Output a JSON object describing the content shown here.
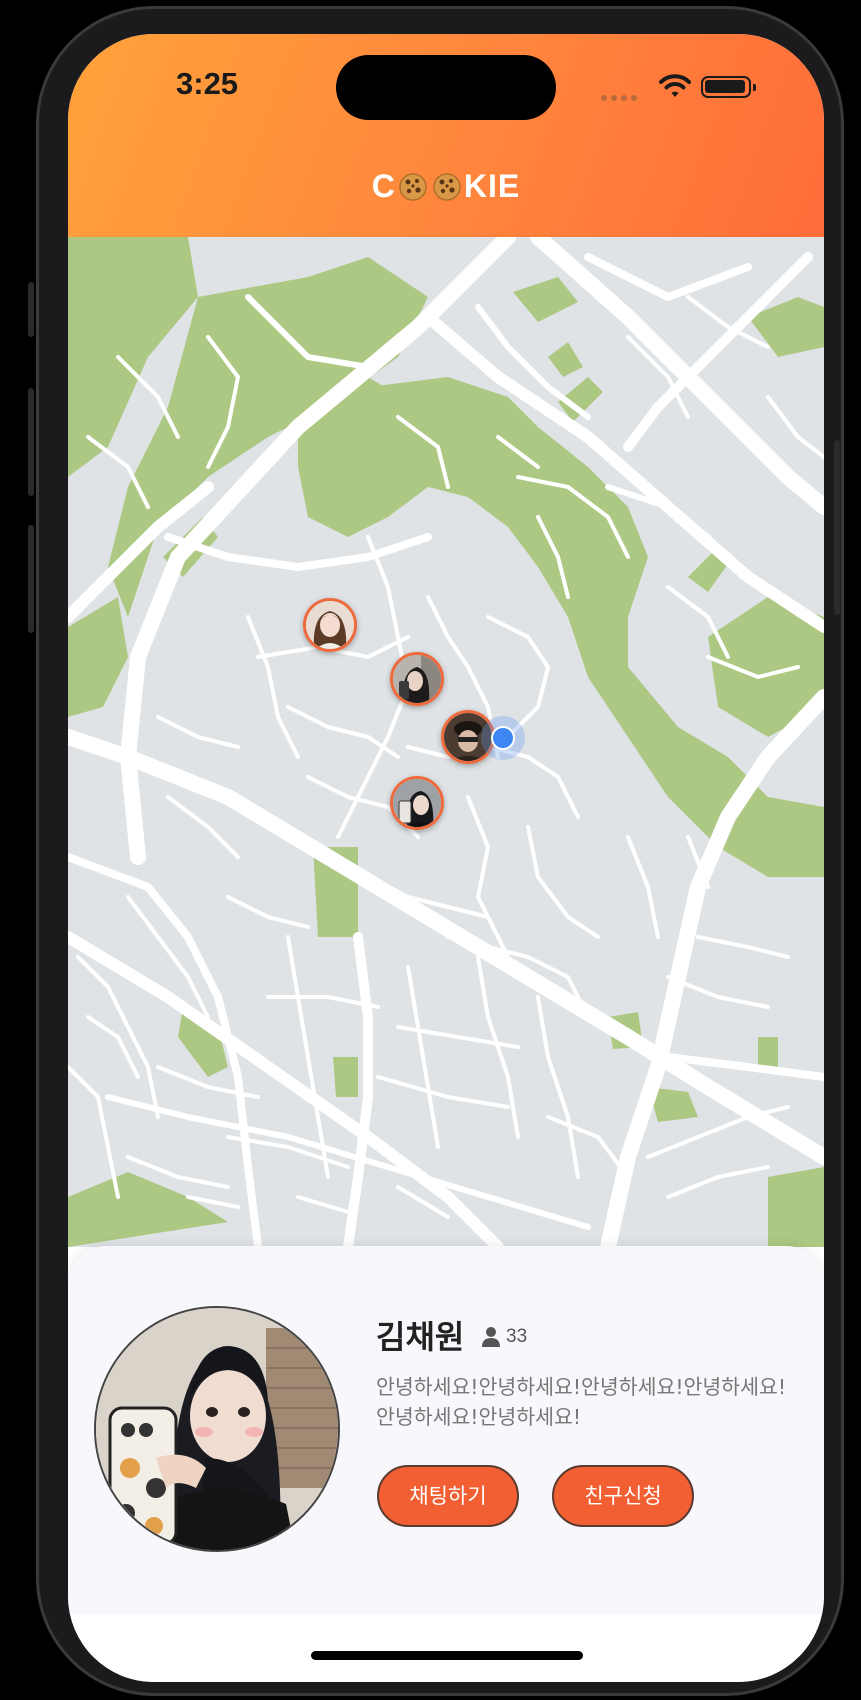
{
  "status_bar": {
    "time": "3:25",
    "icons": [
      "cellular-dots-icon",
      "wifi-icon",
      "battery-icon"
    ]
  },
  "header": {
    "title_start": "C",
    "title_end": "KIE",
    "title_icons": [
      "cookie-icon",
      "cookie-icon"
    ]
  },
  "map": {
    "markers": [
      {
        "name": "friend-marker-1",
        "icon": "avatar"
      },
      {
        "name": "friend-marker-2",
        "icon": "avatar"
      },
      {
        "name": "friend-marker-3",
        "icon": "avatar"
      },
      {
        "name": "friend-marker-4",
        "icon": "avatar"
      }
    ],
    "current_location_icon": "location-dot-icon"
  },
  "profile_card": {
    "name": "김채원",
    "age_icon": "person-icon",
    "age": "33",
    "bio": "안녕하세요!안녕하세요!안녕하세요!안녕하세요!안녕하세요!안녕하세요!",
    "chat_button": "채팅하기",
    "friend_request_button": "친구신청"
  },
  "colors": {
    "header_gradient_start": "#ffa23a",
    "header_gradient_end": "#ff6d3a",
    "accent": "#f25f33",
    "marker_border": "#ee6a3d",
    "location_dot": "#3f86f5",
    "map_land": "#dfe3e6",
    "map_park": "#adc883",
    "map_road": "#ffffff"
  }
}
